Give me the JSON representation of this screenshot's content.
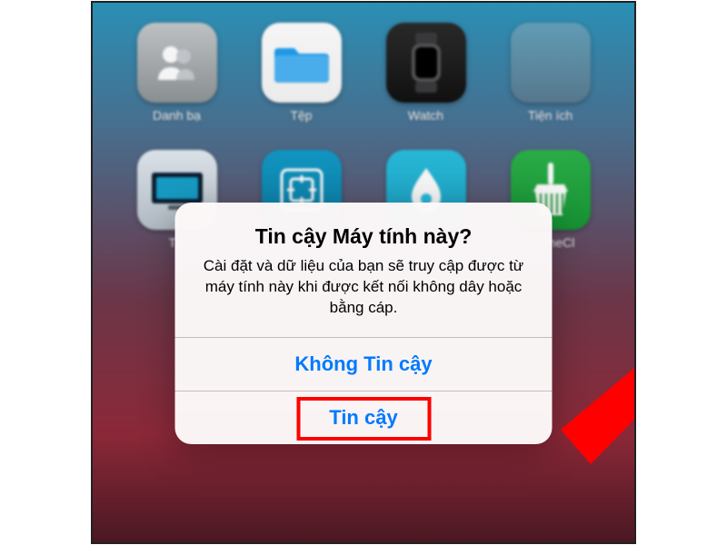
{
  "apps": {
    "contacts": {
      "label": "Danh bạ"
    },
    "files": {
      "label": "Tệp"
    },
    "watch": {
      "label": "Watch"
    },
    "utilities": {
      "label": "Tiện ích"
    },
    "tv": {
      "label": "TV"
    },
    "shortcuts": {
      "label": ""
    },
    "waterminder": {
      "label": ""
    },
    "phoneclean": {
      "label": "PhoneCl"
    }
  },
  "dialog": {
    "title": "Tin cậy Máy tính này?",
    "message": "Cài đặt và dữ liệu của bạn sẽ truy cập được từ máy tính này khi được kết nối không dây hoặc bằng cáp.",
    "dont_trust": "Không Tin cậy",
    "trust": "Tin cậy"
  },
  "annotation": {
    "highlight_target": "trust-button",
    "arrow_target": "trust-button"
  }
}
